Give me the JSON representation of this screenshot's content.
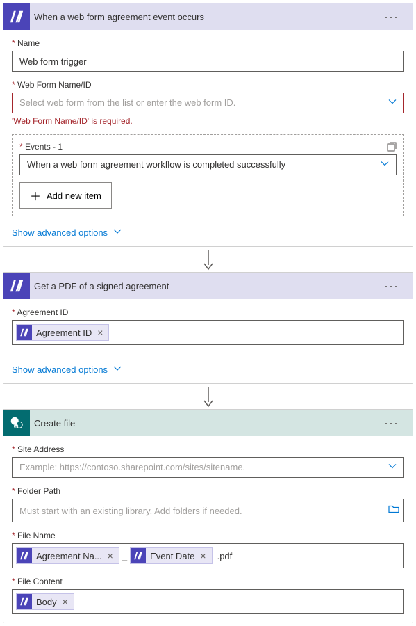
{
  "step1": {
    "title": "When a web form agreement event occurs",
    "name_label": "Name",
    "name_value": "Web form trigger",
    "webform_label": "Web Form Name/ID",
    "webform_placeholder": "Select web form from the list or enter the web form ID.",
    "webform_error": "'Web Form Name/ID' is required.",
    "events_label": "Events - 1",
    "events_selected": "When a web form agreement workflow is completed successfully",
    "add_item": "Add new item",
    "advanced": "Show advanced options"
  },
  "step2": {
    "title": "Get a PDF of a signed agreement",
    "agreement_label": "Agreement ID",
    "token_agreement": "Agreement ID",
    "advanced": "Show advanced options"
  },
  "step3": {
    "title": "Create file",
    "site_label": "Site Address",
    "site_placeholder": "Example: https://contoso.sharepoint.com/sites/sitename.",
    "folder_label": "Folder Path",
    "folder_placeholder": "Must start with an existing library. Add folders if needed.",
    "filename_label": "File Name",
    "token_agreement_name": "Agreement Na...",
    "filename_sep": "_",
    "token_event_date": "Event Date",
    "filename_suffix": ".pdf",
    "filecontent_label": "File Content",
    "token_body": "Body"
  }
}
